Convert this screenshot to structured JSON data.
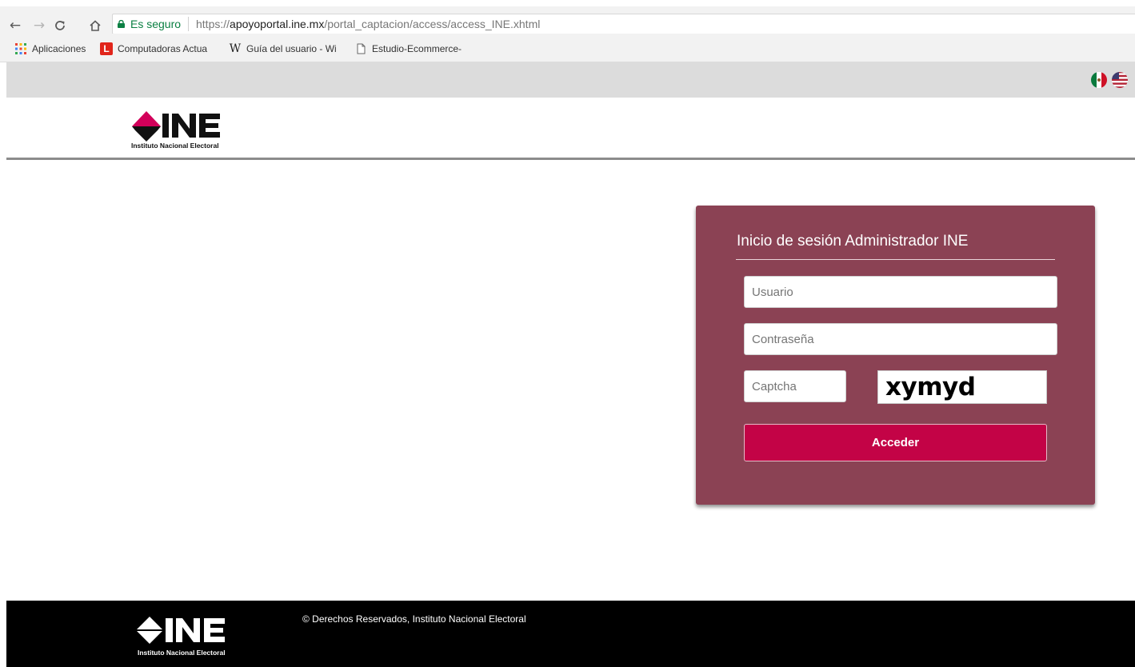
{
  "browser": {
    "secure_label": "Es seguro",
    "url_scheme": "https://",
    "url_host": "apoyoportal.ine.mx",
    "url_path": "/portal_captacion/access/access_INE.xhtml",
    "bookmarks": [
      {
        "label": "Aplicaciones",
        "icon": "apps-grid-icon"
      },
      {
        "label": "Computadoras Actua",
        "icon": "l-logo-icon"
      },
      {
        "label": "Guía del usuario - Wi",
        "icon": "wikipedia-w-icon"
      },
      {
        "label": "Estudio-Ecommerce-",
        "icon": "document-icon"
      }
    ]
  },
  "header": {
    "brand": "INE",
    "brand_subtitle": "Instituto Nacional Electoral",
    "languages": [
      "mexico-flag-icon",
      "usa-flag-icon"
    ]
  },
  "login": {
    "title": "Inicio de sesión Administrador INE",
    "username_placeholder": "Usuario",
    "password_placeholder": "Contraseña",
    "captcha_placeholder": "Captcha",
    "captcha_text": "xymyd",
    "submit_label": "Acceder"
  },
  "footer": {
    "copyright": "© Derechos Reservados, Instituto Nacional Electoral",
    "brand": "INE",
    "brand_subtitle": "Instituto Nacional Electoral"
  },
  "colors": {
    "card_background": "#8b4254",
    "button_background": "#c30346",
    "logo_diamond": "#d2005a",
    "secure_green": "#0b8043"
  }
}
